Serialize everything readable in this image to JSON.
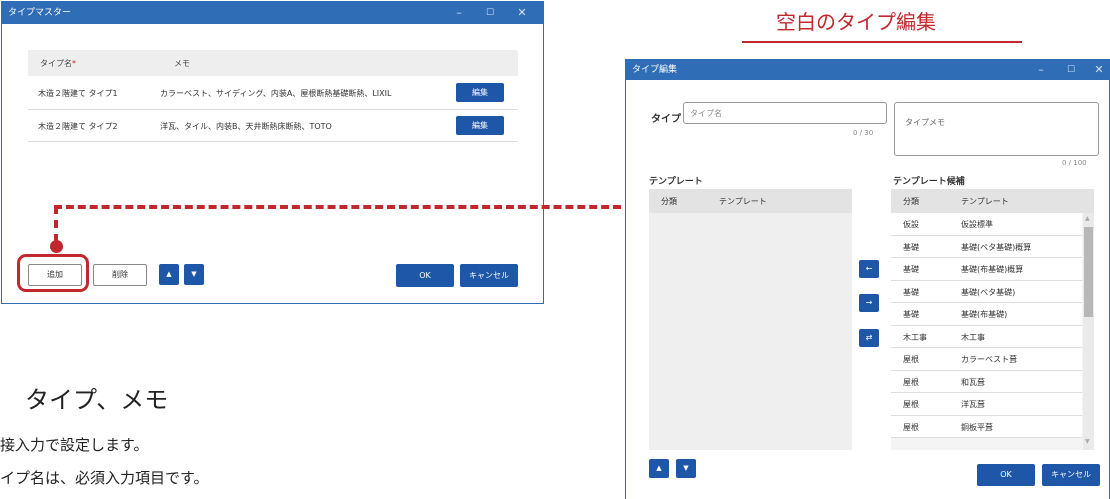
{
  "left_window": {
    "title": "タイプマスター",
    "controls": [
      "–",
      "☐",
      "✕"
    ],
    "table": {
      "headers": {
        "name": "タイプ名",
        "required_mark": "*",
        "memo": "メモ"
      },
      "rows": [
        {
          "name": "木造２階建て タイプ1",
          "memo": "カラーベスト、サイディング、内装A、屋根断熱基礎断熱、LIXIL",
          "button": "編集"
        },
        {
          "name": "木造２階建て タイプ2",
          "memo": "洋瓦、タイル、内装B、天井断熱床断熱、TOTO",
          "button": "編集"
        }
      ]
    },
    "footer": {
      "add": "追加",
      "delete": "削除",
      "up": "▲",
      "down": "▼",
      "ok": "OK",
      "cancel": "キャンセル"
    }
  },
  "heading_blank_edit": "空白のタイプ編集",
  "section_title": "タイプ、メモ",
  "body_lines": [
    "接入力で設定します。",
    "イプ名は、必須入力項目です。"
  ],
  "right_window": {
    "title": "タイプ編集",
    "controls": [
      "–",
      "☐",
      "✕"
    ],
    "type_label": "タイプ",
    "type_placeholder": "タイプ名",
    "type_counter": "0 / 30",
    "memo_placeholder": "タイプメモ",
    "memo_counter": "0 / 100",
    "template_label": "テンプレート",
    "candidate_label": "テンプレート候補",
    "col_category": "分類",
    "col_template": "テンプレート",
    "candidates": [
      {
        "category": "仮設",
        "template": "仮設標準"
      },
      {
        "category": "基礎",
        "template": "基礎(ベタ基礎)概算"
      },
      {
        "category": "基礎",
        "template": "基礎(布基礎)概算"
      },
      {
        "category": "基礎",
        "template": "基礎(ベタ基礎)"
      },
      {
        "category": "基礎",
        "template": "基礎(布基礎)"
      },
      {
        "category": "木工事",
        "template": "木工事"
      },
      {
        "category": "屋根",
        "template": "カラーベスト葺"
      },
      {
        "category": "屋根",
        "template": "和瓦葺"
      },
      {
        "category": "屋根",
        "template": "洋瓦葺"
      },
      {
        "category": "屋根",
        "template": "銅板平葺"
      }
    ],
    "move_left": "←",
    "move_right": "→",
    "swap": "⇄",
    "up": "▲",
    "down": "▼",
    "ok": "OK",
    "cancel": "キャンセル"
  },
  "colors": {
    "accent": "#1f57a8",
    "title_bar": "#2f6db6",
    "callout_red": "#c0282e"
  }
}
